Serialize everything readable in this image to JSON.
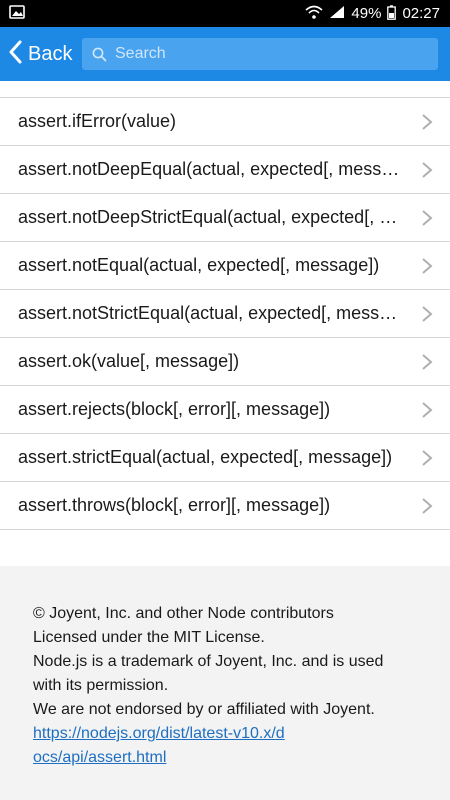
{
  "status_bar": {
    "battery": "49%",
    "time": "02:27",
    "icons": [
      "image-icon",
      "wifi-icon",
      "signal-icon",
      "battery-icon"
    ]
  },
  "app_bar": {
    "back_label": "Back",
    "search_placeholder": "Search",
    "color": "#1e88e5"
  },
  "list": {
    "items": [
      {
        "label": "assert.ifError(value)"
      },
      {
        "label": "assert.notDeepEqual(actual, expected[, message])"
      },
      {
        "label": "assert.notDeepStrictEqual(actual, expected[, message])"
      },
      {
        "label": "assert.notEqual(actual, expected[, message])"
      },
      {
        "label": "assert.notStrictEqual(actual, expected[, message])"
      },
      {
        "label": "assert.ok(value[, message])"
      },
      {
        "label": "assert.rejects(block[, error][, message])"
      },
      {
        "label": "assert.strictEqual(actual, expected[, message])"
      },
      {
        "label": "assert.throws(block[, error][, message])"
      }
    ]
  },
  "footer": {
    "line1": "© Joyent, Inc. and other Node contributors",
    "line2": "Licensed under the MIT License.",
    "line3": "Node.js is a trademark of Joyent, Inc. and is used",
    "line4": "with its permission.",
    "line5": "We are not endorsed by or affiliated with Joyent.",
    "link": "https://nodejs.org/dist/latest-v10.x/docs/api/assert.html"
  }
}
